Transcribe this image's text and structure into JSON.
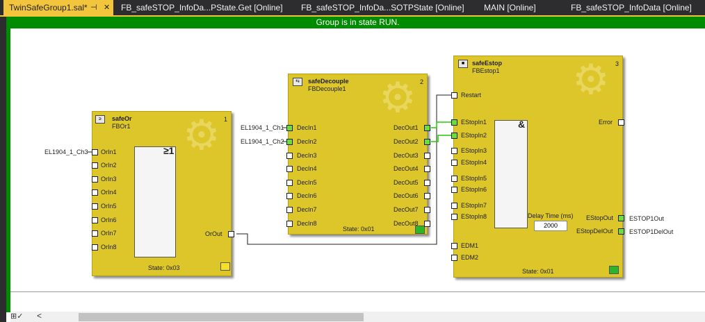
{
  "tabs": [
    {
      "label": "TwinSafeGroup1.sal*",
      "pin": "⊣",
      "close": "✕"
    },
    {
      "label": "FB_safeSTOP_InfoDa...PState.Get [Online]"
    },
    {
      "label": "FB_safeSTOP_InfoDa...SOTPState [Online]"
    },
    {
      "label": "MAIN [Online]"
    },
    {
      "label": "FB_safeSTOP_InfoData [Online]"
    }
  ],
  "status": "Group is in state RUN.",
  "colors": {
    "run_green": "#008c00",
    "block_yellow": "#dcc62a",
    "active_tab": "#f3c53c",
    "signal_green": "#22cc00"
  },
  "blocks": {
    "or": {
      "type": "safeOr",
      "name": "FBOr1",
      "number": "1",
      "symbol": "≥1",
      "state": "State: 0x03",
      "inputs": [
        "OrIn1",
        "OrIn2",
        "OrIn3",
        "OrIn4",
        "OrIn5",
        "OrIn6",
        "OrIn7",
        "OrIn8"
      ],
      "outputs": [
        "OrOut"
      ],
      "indicator": "yellow"
    },
    "decouple": {
      "type": "safeDecouple",
      "name": "FBDecouple1",
      "number": "2",
      "state": "State: 0x01",
      "inputs": [
        "DecIn1",
        "DecIn2",
        "DecIn3",
        "DecIn4",
        "DecIn5",
        "DecIn6",
        "DecIn7",
        "DecIn8"
      ],
      "outputs": [
        "DecOut1",
        "DecOut2",
        "DecOut3",
        "DecOut4",
        "DecOut5",
        "DecOut6",
        "DecOut7",
        "DecOut8"
      ],
      "indicator": "green"
    },
    "estop": {
      "type": "safeEstop",
      "name": "FBEstop1",
      "number": "3",
      "symbol": "&",
      "state": "State: 0x01",
      "inputs": [
        "Restart",
        "EStopIn1",
        "EStopIn2",
        "EStopIn3",
        "EStopIn4",
        "EStopIn5",
        "EStopIn6",
        "EStopIn7",
        "EStopIn8",
        "EDM1",
        "EDM2"
      ],
      "outputs": [
        "Error",
        "EStopOut",
        "EStopDelOut"
      ],
      "delay_label": "Delay Time (ms)",
      "delay_value": "2000",
      "indicator": "green"
    }
  },
  "external": {
    "or_in1": "EL1904_1_Ch3",
    "dec_in1": "EL1904_1_Ch1",
    "dec_in2": "EL1904_1_Ch2",
    "estop_out": "ESTOP1Out",
    "estop_delout": "ESTOP1DelOut"
  }
}
